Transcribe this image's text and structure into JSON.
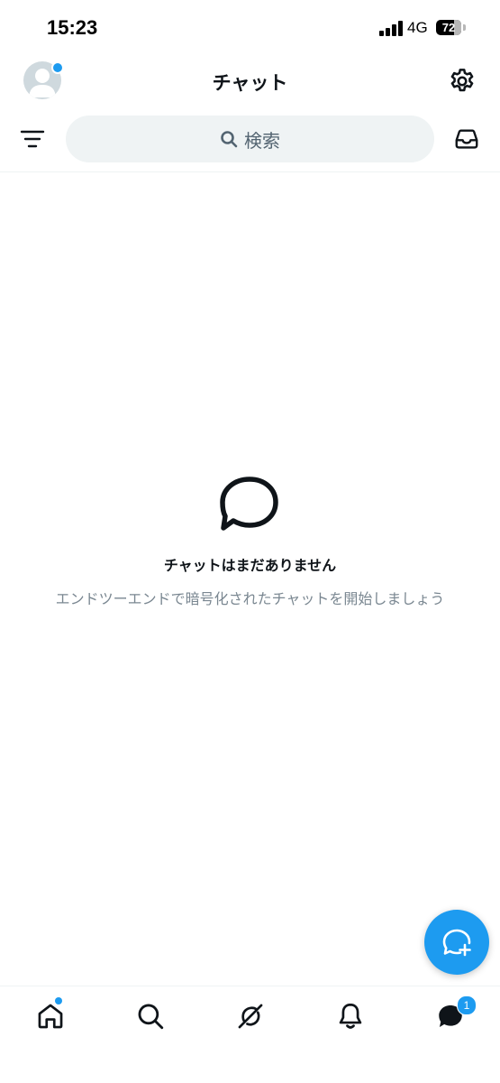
{
  "status_bar": {
    "time": "15:23",
    "network": "4G",
    "battery_level": "72",
    "battery_fraction": 0.72
  },
  "header": {
    "title": "チャット",
    "avatar_notification": true
  },
  "search": {
    "placeholder": "検索"
  },
  "empty_state": {
    "title": "チャットはまだありません",
    "subtitle": "エンドツーエンドで暗号化されたチャットを開始しましょう"
  },
  "bottom_nav": {
    "items": [
      {
        "icon": "home-icon",
        "active": false,
        "dot": true
      },
      {
        "icon": "search-icon",
        "active": false
      },
      {
        "icon": "grok-icon",
        "active": false
      },
      {
        "icon": "bell-icon",
        "active": false
      },
      {
        "icon": "chat-icon",
        "active": true
      }
    ],
    "chat_badge": "1"
  },
  "colors": {
    "accent": "#1d9bf0",
    "text_primary": "#0f1419",
    "text_secondary": "#7a8791",
    "search_bg": "#eff3f4"
  }
}
